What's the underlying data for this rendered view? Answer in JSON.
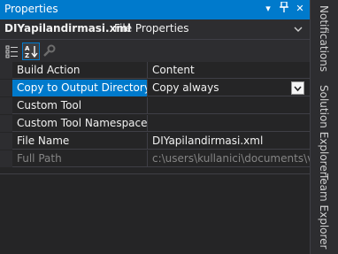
{
  "panel": {
    "title": "Properties",
    "controls": {
      "pin": "▾",
      "autohide": "⊣",
      "close": "✕"
    }
  },
  "object": {
    "name": "DIYapilandirmasi.xml",
    "type": "File Properties"
  },
  "toolbar": {
    "buttons": [
      {
        "name": "categorized",
        "active": false
      },
      {
        "name": "alphabetical",
        "active": true
      },
      {
        "name": "property-pages",
        "active": false
      }
    ]
  },
  "properties": [
    {
      "name": "Build Action",
      "value": "Content",
      "state": "normal"
    },
    {
      "name": "Copy to Output Directory",
      "value": "Copy always",
      "state": "selected",
      "has_dropdown": true
    },
    {
      "name": "Custom Tool",
      "value": "",
      "state": "normal"
    },
    {
      "name": "Custom Tool Namespace",
      "value": "",
      "state": "normal"
    },
    {
      "name": "File Name",
      "value": "DIYapilandirmasi.xml",
      "state": "normal"
    },
    {
      "name": "Full Path",
      "value": "c:\\users\\kullanici\\documents\\vis",
      "state": "disabled"
    }
  ],
  "side_tabs": [
    "Notifications",
    "Solution Explorer",
    "Team Explorer"
  ],
  "colors": {
    "accent": "#007acc",
    "background": "#252526",
    "chrome": "#2d2d30",
    "text": "#f1f1f1",
    "disabled_text": "#848484"
  }
}
